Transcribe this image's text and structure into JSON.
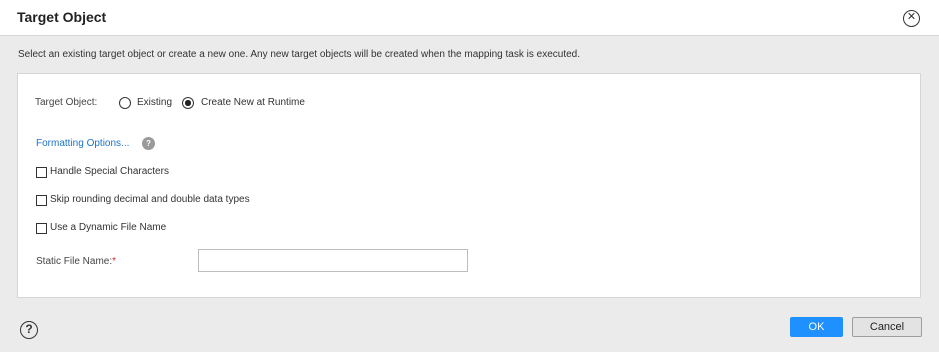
{
  "dialog": {
    "title": "Target Object",
    "close_icon": "close-circle-icon",
    "description": "Select an existing target object or create a new one. Any new target objects will be created when the mapping task is executed."
  },
  "target_object": {
    "label": "Target Object:",
    "options": [
      {
        "label": "Existing",
        "selected": false
      },
      {
        "label": "Create New at Runtime",
        "selected": true
      }
    ]
  },
  "formatting": {
    "link_label": "Formatting Options...",
    "help_badge": "?"
  },
  "checkboxes": [
    {
      "label": "Handle Special Characters",
      "checked": false
    },
    {
      "label": "Skip rounding decimal and double data types",
      "checked": false
    },
    {
      "label": "Use a Dynamic File Name",
      "checked": false
    }
  ],
  "static_file": {
    "label": "Static File Name:",
    "required_mark": "*",
    "value": ""
  },
  "footer": {
    "help_icon": "?",
    "ok_label": "OK",
    "cancel_label": "Cancel"
  },
  "colors": {
    "accent": "#1e90ff",
    "link": "#1a73c8",
    "required": "#d8232a"
  }
}
